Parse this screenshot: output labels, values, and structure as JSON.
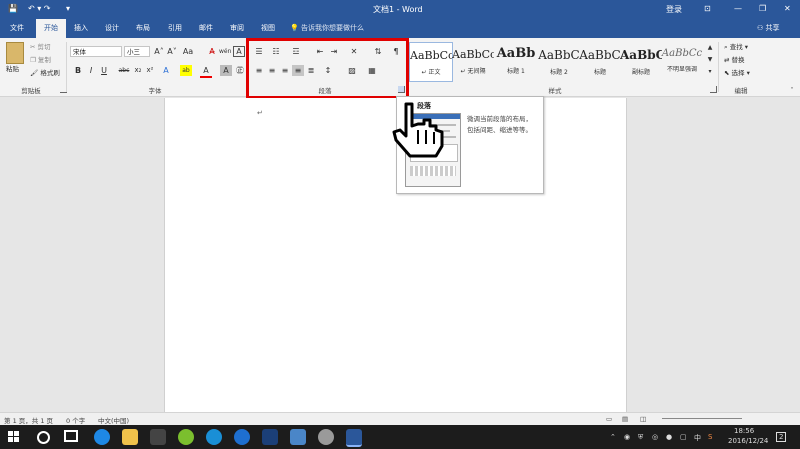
{
  "titlebar": {
    "quick_save": "💾",
    "quick_undo": "↶ ▾ ↷",
    "quick_more": "▾",
    "doc_title": "文档1 - Word",
    "login": "登录",
    "minimize": "—",
    "restore": "❐",
    "close": "✕",
    "ribbon_opts": "⊡"
  },
  "tabs": [
    "文件",
    "开始",
    "插入",
    "设计",
    "布局",
    "引用",
    "邮件",
    "审阅",
    "视图"
  ],
  "search_placeholder": "告诉我你想要做什么",
  "share": "共享",
  "clipboard": {
    "paste": "粘贴",
    "cut": "剪切",
    "copy": "复制",
    "format_painter": "格式刷",
    "label": "剪贴板"
  },
  "font": {
    "name": "宋体",
    "size": "小三",
    "grow": "A˄",
    "shrink": "A˅",
    "case": "Aa",
    "clear": "A̶",
    "wen": "wén",
    "border_a": "A",
    "bold": "B",
    "italic": "I",
    "underline": "U",
    "strike": "abc",
    "sub": "x₂",
    "sup": "x²",
    "effects": "A",
    "highlight": "ab",
    "color": "A",
    "shade": "A",
    "enc": "㊣",
    "label": "字体"
  },
  "paragraph": {
    "label": "段落"
  },
  "styles": {
    "items": [
      {
        "preview": "AaBbCc",
        "name": "↵ 正文"
      },
      {
        "preview": "AaBbCc",
        "name": "↵ 无间隔"
      },
      {
        "preview": "AaBb",
        "name": "标题 1"
      },
      {
        "preview": "AaBbC",
        "name": "标题 2"
      },
      {
        "preview": "AaBbC",
        "name": "标题"
      },
      {
        "preview": "AaBbC",
        "name": "副标题"
      },
      {
        "preview": "AaBbCc",
        "name": "不明显强调"
      }
    ],
    "label": "样式"
  },
  "editing": {
    "find": "查找",
    "replace": "替换",
    "select": "选择",
    "label": "编辑"
  },
  "doc": {
    "para_mark": "↵"
  },
  "tooltip": {
    "title": "段落",
    "desc1": "微调当前段落的布局，",
    "desc2": "包括间距、缩进等等。"
  },
  "status": {
    "page": "第 1 页，共 1 页",
    "words": "0 个字",
    "lang": "中文(中国)"
  },
  "taskbar": {
    "time": "18:56",
    "date": "2016/12/24",
    "ime_ch": "中",
    "ime_s": "S",
    "notify": "2"
  },
  "colors": {
    "accent": "#2b579a",
    "highlight": "#e00000",
    "taskbar": "#1c1c1c"
  }
}
